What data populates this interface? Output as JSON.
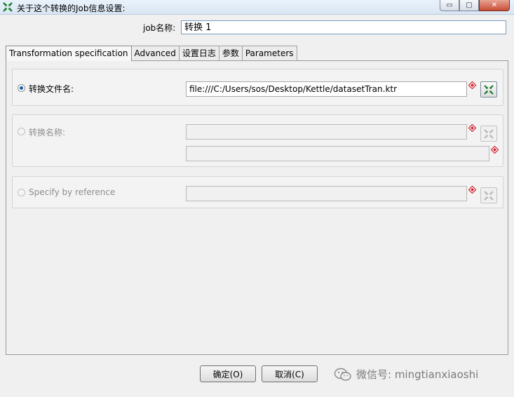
{
  "window": {
    "title": "关于这个转换的Job信息设置:",
    "controls": {
      "minimize": "▭",
      "maximize": "▢",
      "close": "✕"
    }
  },
  "job_name": {
    "label": "job名称:",
    "value": "转换 1"
  },
  "tabs": [
    {
      "label": "Transformation specification",
      "active": true
    },
    {
      "label": "Advanced",
      "active": false
    },
    {
      "label": "设置日志",
      "active": false
    },
    {
      "label": "参数",
      "active": false
    },
    {
      "label": "Parameters",
      "active": false
    }
  ],
  "sections": {
    "filename": {
      "label": "转换文件名:",
      "selected": true,
      "value": "file:///C:/Users/sos/Desktop/Kettle/datasetTran.ktr"
    },
    "repository": {
      "label": "转换名称:",
      "selected": false,
      "value": "",
      "directory_value": ""
    },
    "reference": {
      "label": "Specify by reference",
      "selected": false,
      "value": ""
    }
  },
  "buttons": {
    "ok": "确定(O)",
    "cancel": "取消(C)"
  },
  "watermark": {
    "text": "微信号: mingtianxiaoshi"
  },
  "icons": {
    "app": "kettle-icon",
    "variable": "variable-diamond-icon",
    "browse": "browse-arrows-icon",
    "watermark": "wechat-icon"
  },
  "colors": {
    "variable_diamond": "#d0202c",
    "browse_active": "#1e7d32",
    "browse_disabled": "#b8b8b8"
  }
}
